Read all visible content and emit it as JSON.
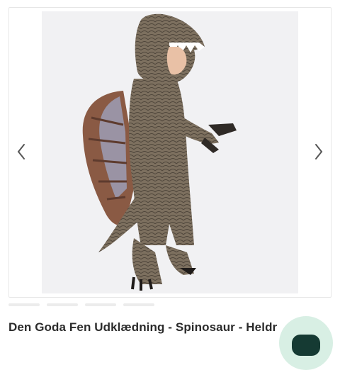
{
  "product": {
    "title": "Den Goda Fen Udklædning - Spinosaur - Heldr",
    "image_alt": "Child wearing spinosaurus dinosaur costume"
  },
  "gallery": {
    "prev_icon": "chevron-left-icon",
    "next_icon": "chevron-right-icon",
    "thumbnail_count": 4
  },
  "chat": {
    "icon": "chat-icon",
    "color": "#d8efe4",
    "icon_color": "#153a33"
  },
  "colors": {
    "title_text": "#2b2b2b",
    "image_background": "#f1f1f3",
    "arrow": "#555555"
  }
}
